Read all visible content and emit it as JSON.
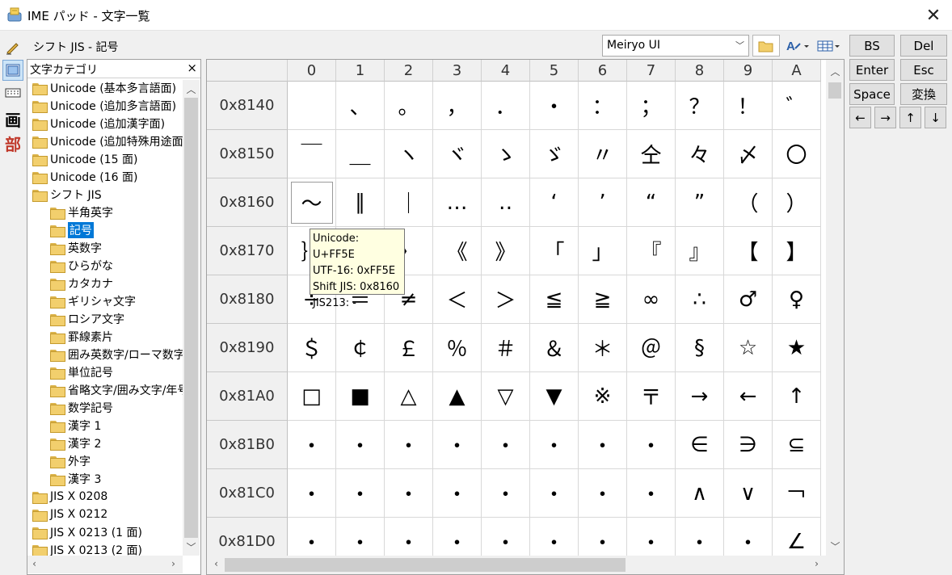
{
  "window": {
    "title": "IME パッド - 文字一覧",
    "close_glyph": "✕"
  },
  "mode_strip": {
    "items": [
      {
        "name": "handwriting-mode-icon",
        "glyph": "✍"
      },
      {
        "name": "char-list-mode-icon",
        "glyph": "▦",
        "selected": true
      },
      {
        "name": "soft-keyboard-mode-icon",
        "glyph": "⌨"
      },
      {
        "name": "stroke-count-mode-icon",
        "glyph": "画"
      },
      {
        "name": "radical-mode-icon",
        "glyph": "部"
      }
    ]
  },
  "header": {
    "title": "シフト JIS - 記号",
    "font_name": "Meiryo UI"
  },
  "category_panel": {
    "title": "文字カテゴリ",
    "close_glyph": "×",
    "items": [
      {
        "label": "Unicode (基本多言語面)",
        "level": 0
      },
      {
        "label": "Unicode (追加多言語面)",
        "level": 0
      },
      {
        "label": "Unicode (追加漢字面)",
        "level": 0
      },
      {
        "label": "Unicode (追加特殊用途面)",
        "level": 0
      },
      {
        "label": "Unicode (15 面)",
        "level": 0
      },
      {
        "label": "Unicode (16 面)",
        "level": 0
      },
      {
        "label": "シフト JIS",
        "level": 0
      },
      {
        "label": "半角英字",
        "level": 1
      },
      {
        "label": "記号",
        "level": 1,
        "selected": true
      },
      {
        "label": "英数字",
        "level": 1
      },
      {
        "label": "ひらがな",
        "level": 1
      },
      {
        "label": "カタカナ",
        "level": 1
      },
      {
        "label": "ギリシャ文字",
        "level": 1
      },
      {
        "label": "ロシア文字",
        "level": 1
      },
      {
        "label": "罫線素片",
        "level": 1
      },
      {
        "label": "囲み英数字/ローマ数字",
        "level": 1
      },
      {
        "label": "単位記号",
        "level": 1
      },
      {
        "label": "省略文字/囲み文字/年号",
        "level": 1
      },
      {
        "label": "数学記号",
        "level": 1
      },
      {
        "label": "漢字 1",
        "level": 1
      },
      {
        "label": "漢字 2",
        "level": 1
      },
      {
        "label": "外字",
        "level": 1
      },
      {
        "label": "漢字 3",
        "level": 1
      },
      {
        "label": "JIS X 0208",
        "level": 0
      },
      {
        "label": "JIS X 0212",
        "level": 0
      },
      {
        "label": "JIS X 0213 (1 面)",
        "level": 0
      },
      {
        "label": "JIS X 0213 (2 面)",
        "level": 0
      }
    ]
  },
  "grid": {
    "columns": [
      "0",
      "1",
      "2",
      "3",
      "4",
      "5",
      "6",
      "7",
      "8",
      "9",
      "A"
    ],
    "rows": [
      {
        "code": "0x8140",
        "chars": [
          " ",
          "、",
          "。",
          "，",
          "．",
          "・",
          "：",
          "；",
          "？",
          "！",
          "゛"
        ]
      },
      {
        "code": "0x8150",
        "chars": [
          "￣",
          "＿",
          "ヽ",
          "ヾ",
          "ゝ",
          "ゞ",
          "〃",
          "仝",
          "々",
          "〆",
          "〇"
        ]
      },
      {
        "code": "0x8160",
        "chars": [
          "～",
          "∥",
          "｜",
          "…",
          "‥",
          "‘",
          "’",
          "“",
          "”",
          "（",
          "）"
        ]
      },
      {
        "code": "0x8170",
        "chars": [
          "｝",
          "〈",
          "〉",
          "《",
          "》",
          "「",
          "」",
          "『",
          "』",
          "【",
          "】"
        ]
      },
      {
        "code": "0x8180",
        "chars": [
          "÷",
          "＝",
          "≠",
          "＜",
          "＞",
          "≦",
          "≧",
          "∞",
          "∴",
          "♂",
          "♀"
        ]
      },
      {
        "code": "0x8190",
        "chars": [
          "＄",
          "￠",
          "￡",
          "％",
          "＃",
          "＆",
          "＊",
          "＠",
          "§",
          "☆",
          "★"
        ]
      },
      {
        "code": "0x81A0",
        "chars": [
          "□",
          "■",
          "△",
          "▲",
          "▽",
          "▼",
          "※",
          "〒",
          "→",
          "←",
          "↑"
        ]
      },
      {
        "code": "0x81B0",
        "chars": [
          "・",
          "・",
          "・",
          "・",
          "・",
          "・",
          "・",
          "・",
          "∈",
          "∋",
          "⊆"
        ]
      },
      {
        "code": "0x81C0",
        "chars": [
          "・",
          "・",
          "・",
          "・",
          "・",
          "・",
          "・",
          "・",
          "∧",
          "∨",
          "￢"
        ]
      },
      {
        "code": "0x81D0",
        "chars": [
          "・",
          "・",
          "・",
          "・",
          "・",
          "・",
          "・",
          "・",
          "・",
          "・",
          "∠"
        ]
      }
    ]
  },
  "tooltip": {
    "line1": "Unicode: U+FF5E",
    "line2": "UTF-16: 0xFF5E",
    "line3": "Shift JIS: 0x8160",
    "line4": "JIS213: -"
  },
  "keys": {
    "bs": "BS",
    "del": "Del",
    "enter": "Enter",
    "esc": "Esc",
    "space": "Space",
    "convert": "変換",
    "left": "←",
    "right": "→",
    "up": "↑",
    "down": "↓"
  },
  "colors": {
    "selection": "#0078d7",
    "tooltip_bg": "#ffffe1"
  }
}
